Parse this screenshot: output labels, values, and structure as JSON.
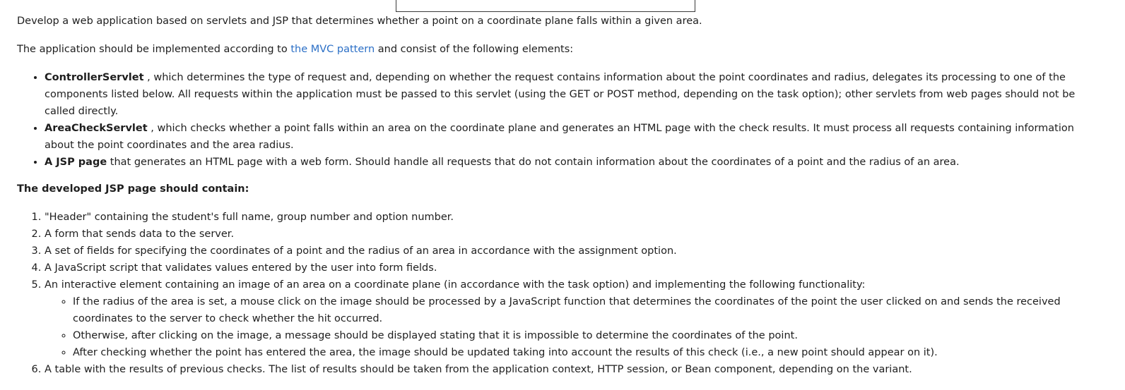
{
  "intro": "Develop a web application based on servlets and JSP that determines whether a point on a coordinate plane falls within a given area.",
  "mvc_sentence": {
    "before": "The application should be implemented according to ",
    "link": "the MVC pattern",
    "after": " and consist of the following elements:"
  },
  "elements": [
    {
      "name": "ControllerServlet",
      "text": " , which determines the type of request and, depending on whether the request contains information about the point coordinates and radius, delegates its processing to one of the components listed below. All requests within the application must be passed to this servlet (using the GET or POST method, depending on the task option); other servlets from web pages should not be called directly."
    },
    {
      "name": "AreaCheckServlet",
      "text": " , which checks whether a point falls within an area on the coordinate plane and generates an HTML page with the check results. It must process all requests containing information about the point coordinates and the area radius."
    },
    {
      "name": "A JSP page",
      "text": " that generates an HTML page with a web form. Should handle all requests that do not contain information about the coordinates of a point and the radius of an area."
    }
  ],
  "jsp_heading": "The developed JSP page should contain:",
  "requirements": [
    "\"Header\" containing the student's full name, group number and option number.",
    "A form that sends data to the server.",
    "A set of fields for specifying the coordinates of a point and the radius of an area in accordance with the assignment option.",
    "A JavaScript script that validates values entered by the user into form fields.",
    "An interactive element containing an image of an area on a coordinate plane (in accordance with the task option) and implementing the following functionality:",
    "A table with the results of previous checks. The list of results should be taken from the application context, HTTP session, or Bean component, depending on the variant."
  ],
  "interactive_sub": [
    "If the radius of the area is set, a mouse click on the image should be processed by a JavaScript function that determines the coordinates of the point the user clicked on and sends the received coordinates to the server to check whether the hit occurred.",
    "Otherwise, after clicking on the image, a message should be displayed stating that it is impossible to determine the coordinates of the point.",
    "After checking whether the point has entered the area, the image should be updated taking into account the results of this check (i.e., a new point should appear on it)."
  ]
}
